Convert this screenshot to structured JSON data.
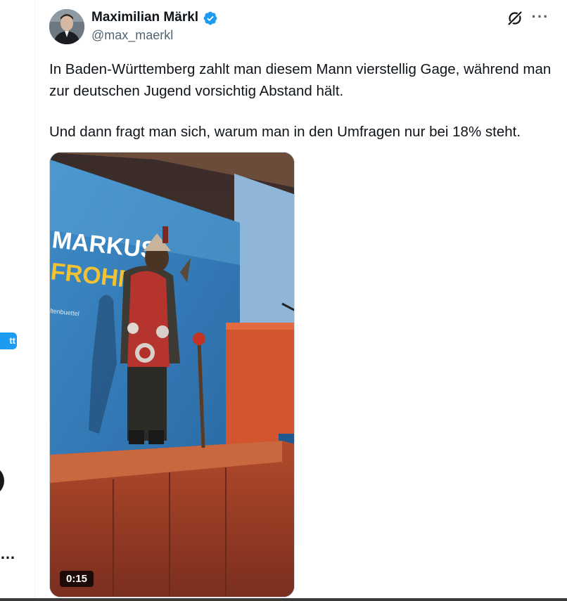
{
  "sidebar": {
    "post_button_fragment": "tt",
    "more_fragment": "…"
  },
  "tweet": {
    "author": {
      "name": "Maximilian Märkl",
      "handle": "@max_maerkl",
      "verified": true
    },
    "text": [
      "In Baden-Württemberg zahlt man diesem Mann vierstellig Gage, während man zur deutschen Jugend vorsichtig Abstand hält.",
      "Und dann fragt man sich, warum man in den Umfragen nur bei 18% steht."
    ],
    "media": {
      "type": "video",
      "duration": "0:15",
      "banner_line1": "MARKUS",
      "banner_line2": "FROHNM",
      "banner_small": "ltenbuettel"
    },
    "more_label": "···"
  },
  "colors": {
    "accent": "#1d9bf0",
    "text_primary": "#0f1419",
    "text_secondary": "#536471"
  },
  "icons": [
    "grok-icon",
    "more-icon",
    "verified-badge-icon"
  ]
}
